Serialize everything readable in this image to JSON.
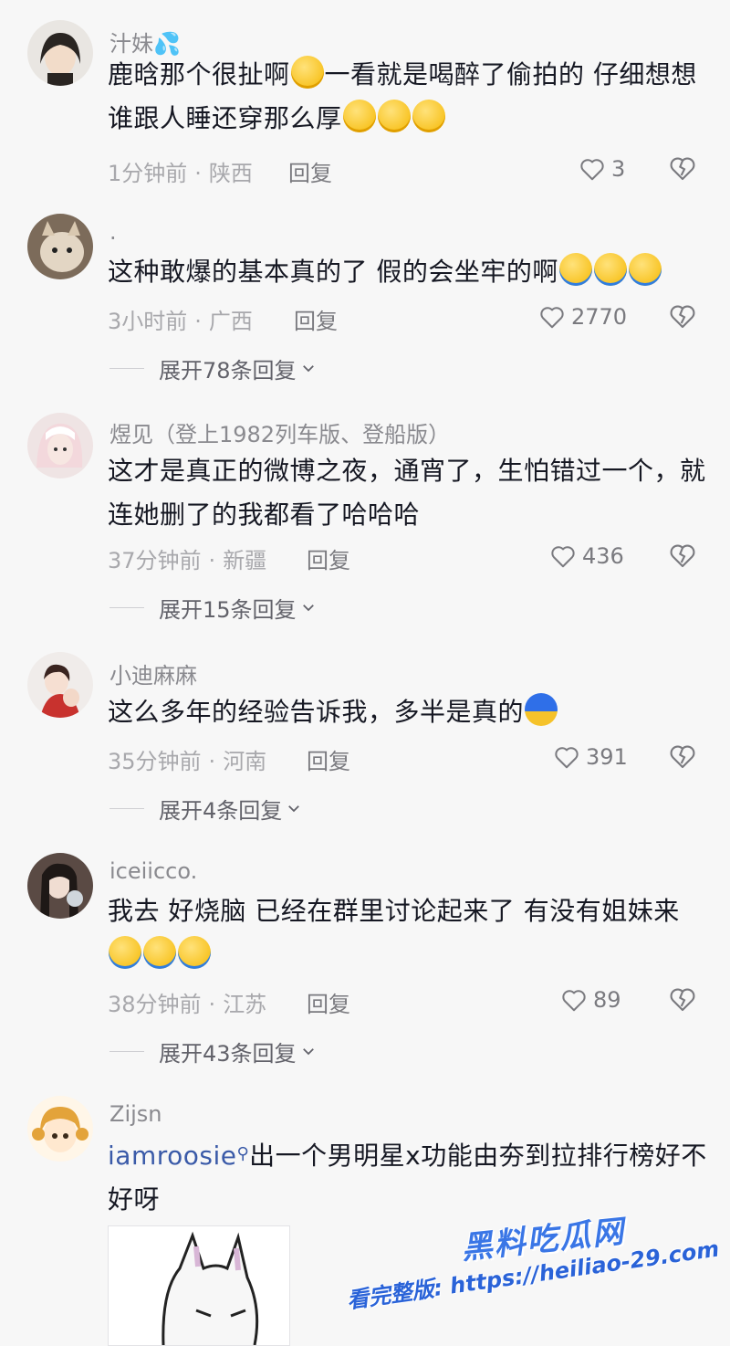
{
  "comments": [
    {
      "username": "汁妹💦",
      "text_parts": [
        "鹿晗那个很扯啊",
        "一看就是喝醉了偷拍的 仔细想想 谁跟人睡还穿那么厚"
      ],
      "emojis": [
        "dizzy",
        "dizzy",
        "dizzy",
        "dizzy"
      ],
      "time": "1分钟前",
      "location": "陕西",
      "reply_label": "回复",
      "likes": "3"
    },
    {
      "username": ".",
      "text": "这种敢爆的基本真的了 假的会坐牢的啊",
      "emojis": [
        "laugh-cry",
        "laugh-cry",
        "laugh-cry"
      ],
      "time": "3小时前",
      "location": "广西",
      "reply_label": "回复",
      "likes": "2770",
      "expand_label": "展开78条回复"
    },
    {
      "username": "煜见（登上1982列车版、登船版）",
      "text": "这才是真正的微博之夜，通宵了，生怕错过一个，就连她删了的我都看了哈哈哈",
      "time": "37分钟前",
      "location": "新疆",
      "reply_label": "回复",
      "likes": "436",
      "expand_label": "展开15条回复"
    },
    {
      "username": "小迪麻麻",
      "text": "这么多年的经验告诉我，多半是真的",
      "emojis": [
        "scared"
      ],
      "time": "35分钟前",
      "location": "河南",
      "reply_label": "回复",
      "likes": "391",
      "expand_label": "展开4条回复"
    },
    {
      "username": "iceiicco.",
      "text": "我去 好烧脑 已经在群里讨论起来了 有没有姐妹来",
      "emojis": [
        "laugh-cry",
        "laugh-cry",
        "laugh-cry"
      ],
      "time": "38分钟前",
      "location": "江苏",
      "reply_label": "回复",
      "likes": "89",
      "expand_label": "展开43条回复"
    },
    {
      "username": "Zijsn",
      "mention": "iamroosie",
      "text": "出一个男明星x功能由夯到拉排行榜好不好呀"
    }
  ],
  "watermark": {
    "title": "黑料吃瓜网",
    "url": "看完整版: https://heiliao-29.com"
  },
  "icons": {
    "like": "heart-outline-icon",
    "dislike": "broken-heart-icon",
    "expand": "chevron-down-icon",
    "search": "search-icon"
  },
  "colors": {
    "background": "#f7f7f7",
    "text": "#161823",
    "meta": "#a8a8ac",
    "mention": "#3a5aa8"
  }
}
